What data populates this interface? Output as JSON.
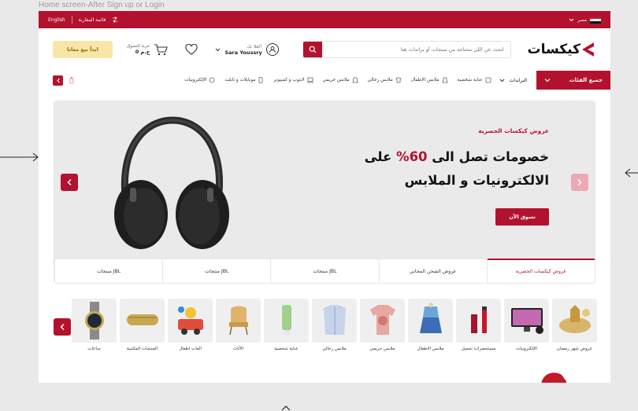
{
  "canvas_label": "Home screen-After Sign up or Login",
  "topbar": {
    "language": "English",
    "compare": "قائمة المقارنة",
    "country": "مصر"
  },
  "header": {
    "sell_button": "ابدأ بيع معانا",
    "cart_label": "عربة التسوق",
    "cart_total": "0 ج.م",
    "greeting": "اهلا بك!",
    "user_name": "Sara Youssry",
    "search_placeholder": "ابحث عن اللي محتاجه من منتجات أو براندات هنا",
    "logo_text": "كيكسات"
  },
  "nav": {
    "all_categories": "جميع الفئات",
    "brands": "البراندات",
    "items": [
      {
        "label": "الإلكترونيات",
        "icon": "electronics-icon"
      },
      {
        "label": "موبايلات و تابلت",
        "icon": "mobile-icon"
      },
      {
        "label": "لابتوب و كمبيوتر",
        "icon": "laptop-icon"
      },
      {
        "label": "ملابس حريمي",
        "icon": "women-clothes-icon"
      },
      {
        "label": "ملابس رجالي",
        "icon": "men-clothes-icon"
      },
      {
        "label": "ملابس الاطفال",
        "icon": "kids-clothes-icon"
      },
      {
        "label": "عناية شخصية",
        "icon": "personal-care-icon"
      }
    ]
  },
  "hero": {
    "kicker": "عروض كيكسات الحصرية",
    "headline_part1": "خصومات تصل الى",
    "headline_pct": "60%",
    "headline_part2": "على",
    "headline_line2": "الالكترونيات و الملابس",
    "shop_button": "تسوق الآن",
    "tabs": [
      {
        "label": "عروض كيكسات الحصرية",
        "active": true
      },
      {
        "label": "عروض الشحن المجاني",
        "active": false
      },
      {
        "label": "منتجات JBL",
        "active": false
      },
      {
        "label": "منتجات JBL",
        "active": false
      },
      {
        "label": "منتجات JBL",
        "active": false
      }
    ]
  },
  "categories": [
    {
      "label": "عروض شهر رمضان",
      "icon": "ramadan-lantern-icon"
    },
    {
      "label": "الإلكترونيات",
      "icon": "tv-icon"
    },
    {
      "label": "مستحضرات تجميل",
      "icon": "lipstick-icon"
    },
    {
      "label": "ملابس الاطفال",
      "icon": "kids-outfit-icon"
    },
    {
      "label": "ملابس حريمي",
      "icon": "blouse-icon"
    },
    {
      "label": "ملابس رجالي",
      "icon": "shirt-icon"
    },
    {
      "label": "عناية شخصية",
      "icon": "skincare-tube-icon"
    },
    {
      "label": "الأثاث",
      "icon": "chair-icon"
    },
    {
      "label": "العاب اطفال",
      "icon": "toys-icon"
    },
    {
      "label": "المنتجات المكتبية",
      "icon": "pencil-case-icon"
    },
    {
      "label": "ساعات",
      "icon": "watch-icon"
    }
  ],
  "colors": {
    "brand": "#b3122e",
    "accent_light": "#f7e6a6"
  }
}
